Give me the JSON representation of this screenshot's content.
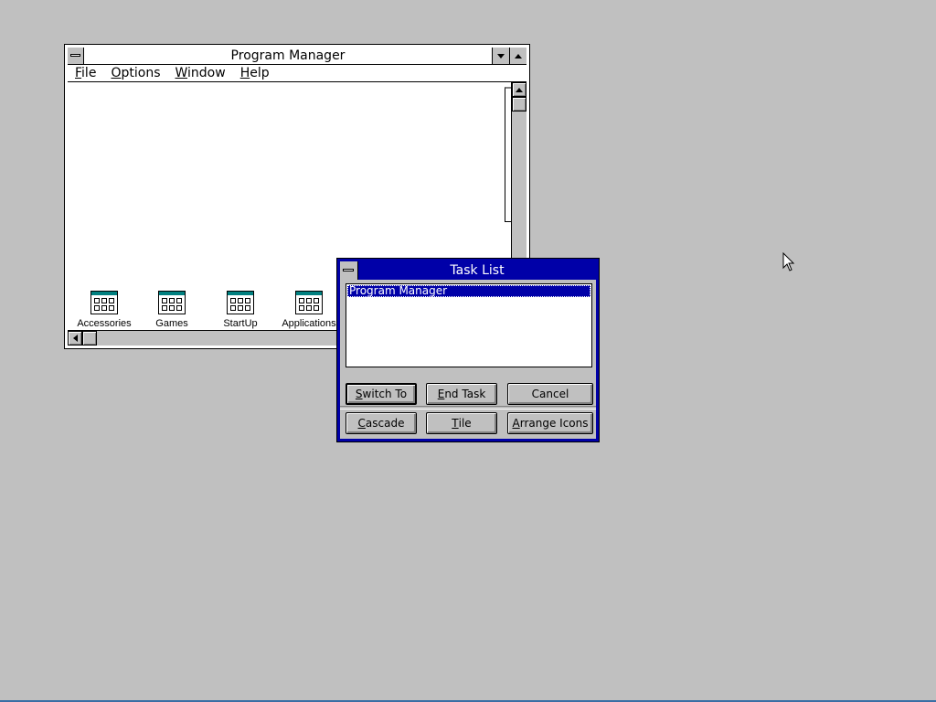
{
  "program_manager": {
    "title": "Program Manager",
    "menu": [
      {
        "label": "File",
        "mnemonic": "F",
        "rest": "ile"
      },
      {
        "label": "Options",
        "mnemonic": "O",
        "rest": "ptions"
      },
      {
        "label": "Window",
        "mnemonic": "W",
        "rest": "indow"
      },
      {
        "label": "Help",
        "mnemonic": "H",
        "rest": "elp"
      }
    ],
    "groups": [
      {
        "label": "Accessories"
      },
      {
        "label": "Games"
      },
      {
        "label": "StartUp"
      },
      {
        "label": "Applications"
      }
    ]
  },
  "task_list": {
    "title": "Task List",
    "items": [
      "Program Manager"
    ],
    "buttons": {
      "switch_to": {
        "mnemonic": "S",
        "rest": "witch To"
      },
      "end_task": {
        "mnemonic": "E",
        "rest": "nd Task"
      },
      "cancel": {
        "label": "Cancel"
      },
      "cascade": {
        "mnemonic": "C",
        "rest": "ascade"
      },
      "tile": {
        "mnemonic": "T",
        "rest": "ile"
      },
      "arrange_icons": {
        "mnemonic": "A",
        "rest": "rrange Icons"
      }
    }
  },
  "colors": {
    "desktop": "#c0c0c0",
    "active_title": "#0000a8",
    "inactive_title": "#ffffff"
  },
  "icons": [
    "control-menu-icon",
    "minimize-icon",
    "maximize-icon",
    "scroll-up-icon",
    "scroll-left-icon",
    "program-group-icon",
    "mouse-pointer-icon"
  ]
}
